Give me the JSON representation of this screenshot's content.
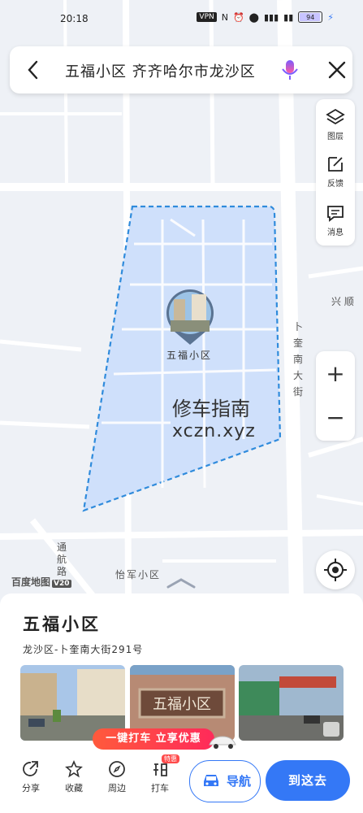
{
  "status_bar": {
    "time": "20:18",
    "vpn": "VPN",
    "battery": "94"
  },
  "search": {
    "query": "五福小区 齐齐哈尔市龙沙区"
  },
  "map_tools": {
    "layers": "图层",
    "feedback": "反馈",
    "messages": "消息"
  },
  "zoom": {
    "in": "+",
    "out": "−"
  },
  "map_labels": {
    "street_vertical": "卜奎南大街",
    "xingshun": "兴 顺",
    "tonghang": "通航路",
    "yijun": "怡军小区",
    "logo": "百度地图",
    "logo_version": "V20"
  },
  "poi": {
    "label": "五福小区"
  },
  "watermark": {
    "line1": "修车指南",
    "line2": "xczn.xyz"
  },
  "place": {
    "title": "五福小区",
    "address": "龙沙区-卜奎南大街291号"
  },
  "promo": {
    "text": "一键打车 立享优惠"
  },
  "bottom_nav": {
    "share": "分享",
    "favorite": "收藏",
    "nearby": "周边",
    "taxi": "打车",
    "taxi_tag": "特惠",
    "navigate": "导航",
    "go_here": "到这去"
  },
  "colors": {
    "accent": "#3478f6",
    "area_fill": "#cfe0fb",
    "area_border": "#2f8bdc",
    "promo": "#ff3a4a"
  }
}
